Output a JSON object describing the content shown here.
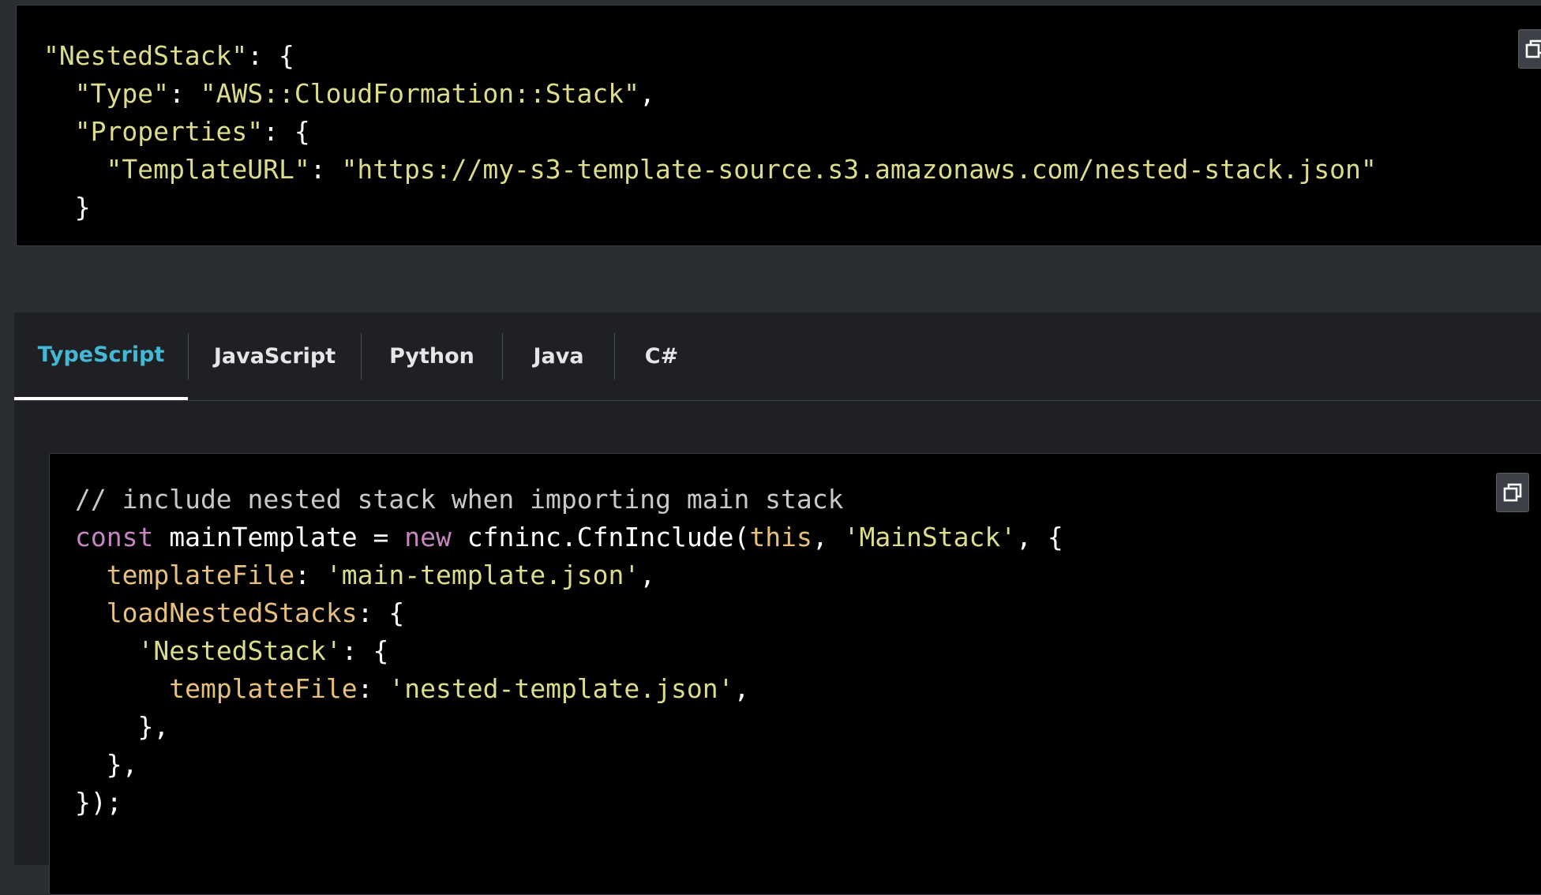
{
  "top_code": {
    "lines": [
      [
        "\"NestedStack\"",
        ": {"
      ],
      [
        "  ",
        "\"Type\"",
        ": ",
        "\"AWS::CloudFormation::Stack\"",
        ","
      ],
      [
        "  ",
        "\"Properties\"",
        ": {"
      ],
      [
        "    ",
        "\"TemplateURL\"",
        ": ",
        "\"https://my-s3-template-source.s3.amazonaws.com/nested-stack.json\""
      ],
      [
        "  }"
      ]
    ],
    "copy_icon": "copy-icon"
  },
  "tabs": [
    {
      "label": "TypeScript",
      "active": true
    },
    {
      "label": "JavaScript",
      "active": false
    },
    {
      "label": "Python",
      "active": false
    },
    {
      "label": "Java",
      "active": false
    },
    {
      "label": "C#",
      "active": false
    }
  ],
  "bottom_code": {
    "comment": "// include nested stack when importing main stack",
    "l2": {
      "kw1": "const",
      "name": " mainTemplate = ",
      "kw2": "new",
      "call": " cfninc.CfnInclude(",
      "this": "this",
      "sep": ", ",
      "str": "'MainStack'",
      "end": ", {"
    },
    "l3": {
      "indent": "  ",
      "key": "templateFile",
      "sep": ": ",
      "str": "'main-template.json'",
      "end": ","
    },
    "l4": {
      "indent": "  ",
      "key": "loadNestedStacks",
      "end": ": {"
    },
    "l5": {
      "indent": "    ",
      "str": "'NestedStack'",
      "end": ": {"
    },
    "l6": {
      "indent": "      ",
      "key": "templateFile",
      "sep": ": ",
      "str": "'nested-template.json'",
      "end": ","
    },
    "l7": "    },",
    "l8": "  },",
    "l9": "});",
    "copy_icon": "copy-icon"
  },
  "colors": {
    "tab_active": "#44b9d6",
    "string": "#dcdc8b",
    "keyword": "#c586c0",
    "property": "#e8c07d"
  }
}
